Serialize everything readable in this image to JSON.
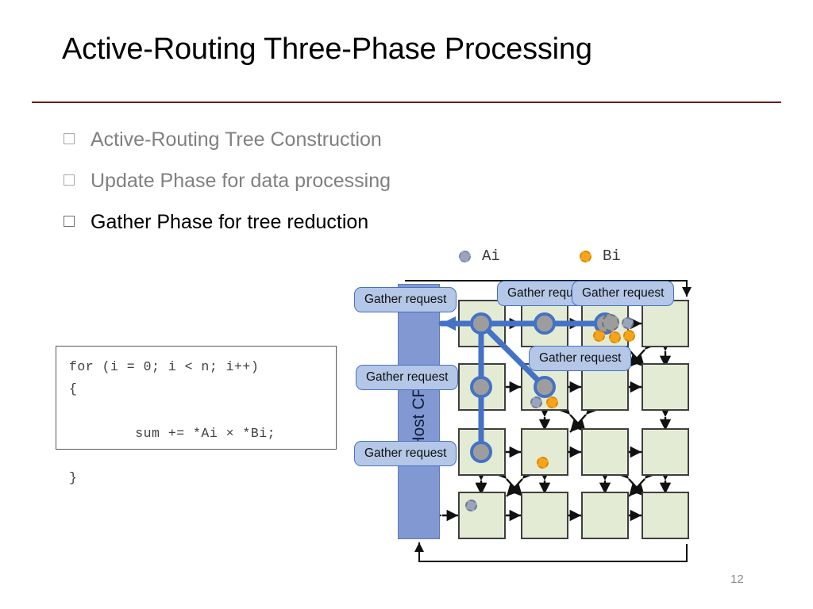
{
  "slide": {
    "title": "Active-Routing Three-Phase Processing",
    "page_number": "12",
    "accent_rule_color": "#6e1a1a"
  },
  "bullets": [
    {
      "label": "Active-Routing Tree Construction",
      "state": "dim"
    },
    {
      "label": "Update Phase for data processing",
      "state": "dim"
    },
    {
      "label": "Gather Phase for tree reduction",
      "state": "active"
    }
  ],
  "code_box": {
    "text": "for (i = 0; i < n; i++)\n{\n\n        sum += *Ai × *Bi;\n\n}"
  },
  "legend": {
    "items": [
      {
        "label": "Ai",
        "color": "#9aa5bd"
      },
      {
        "label": "Bi",
        "color": "#f5a51c"
      }
    ]
  },
  "diagram": {
    "host_cpu_label": "Host CPU",
    "callouts": [
      {
        "label": "Gather request"
      },
      {
        "label": "Gather request"
      },
      {
        "label": "Gather request"
      },
      {
        "label": "Gather request"
      },
      {
        "label": "Gather request"
      },
      {
        "label": "Gather request"
      }
    ],
    "colors": {
      "cell_fill": "#e3ebd5",
      "cell_border": "#3f3f3f",
      "host_cpu_fill": "#8198d3",
      "tree_link": "#4472c4",
      "node_fill": "#9d9d9d",
      "callout_fill": "#b4c7e7",
      "callout_border": "#4472c4"
    },
    "grid": {
      "rows": 4,
      "cols": 4
    }
  }
}
